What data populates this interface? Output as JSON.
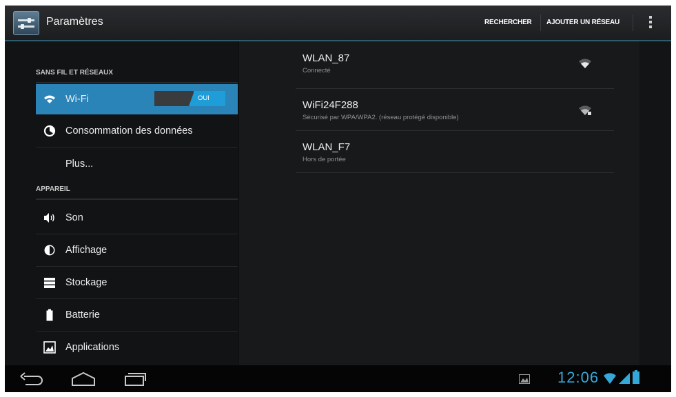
{
  "app": {
    "title": "Paramètres",
    "icon": "settings-app-icon"
  },
  "actions": {
    "search": "RECHERCHER",
    "add_network": "AJOUTER UN RÉSEAU",
    "overflow_icon": "overflow-menu-icon"
  },
  "sidebar": {
    "section_wireless": "SANS FIL ET RÉSEAUX",
    "section_device": "APPAREIL",
    "items": [
      {
        "label": "Wi-Fi",
        "icon": "wifi-icon",
        "selected": true,
        "toggle": "OUI"
      },
      {
        "label": "Consommation des données",
        "icon": "data-usage-icon"
      },
      {
        "label": "Plus...",
        "icon": ""
      },
      {
        "label": "Son",
        "icon": "speaker-icon"
      },
      {
        "label": "Affichage",
        "icon": "display-icon"
      },
      {
        "label": "Stockage",
        "icon": "storage-icon"
      },
      {
        "label": "Batterie",
        "icon": "battery-icon"
      },
      {
        "label": "Applications",
        "icon": "applications-icon"
      }
    ]
  },
  "networks": [
    {
      "name": "WLAN_87",
      "status": "Connecté",
      "signal_icon": "wifi-signal-icon"
    },
    {
      "name": "WiFi24F288",
      "status": "Sécurisé par WPA/WPA2. (réseau protégé disponible)",
      "signal_icon": "wifi-lock-signal-icon"
    },
    {
      "name": "WLAN_F7",
      "status": "Hors de portée"
    }
  ],
  "navbar": {
    "back_icon": "back-icon",
    "home_icon": "home-icon",
    "recents_icon": "recent-apps-icon"
  },
  "status": {
    "time": "12:06",
    "notification_icon": "gallery-notification-icon"
  },
  "colors": {
    "accent": "#2a84b8",
    "toggle_on": "#1f9dd8",
    "clock": "#36a8d8"
  }
}
